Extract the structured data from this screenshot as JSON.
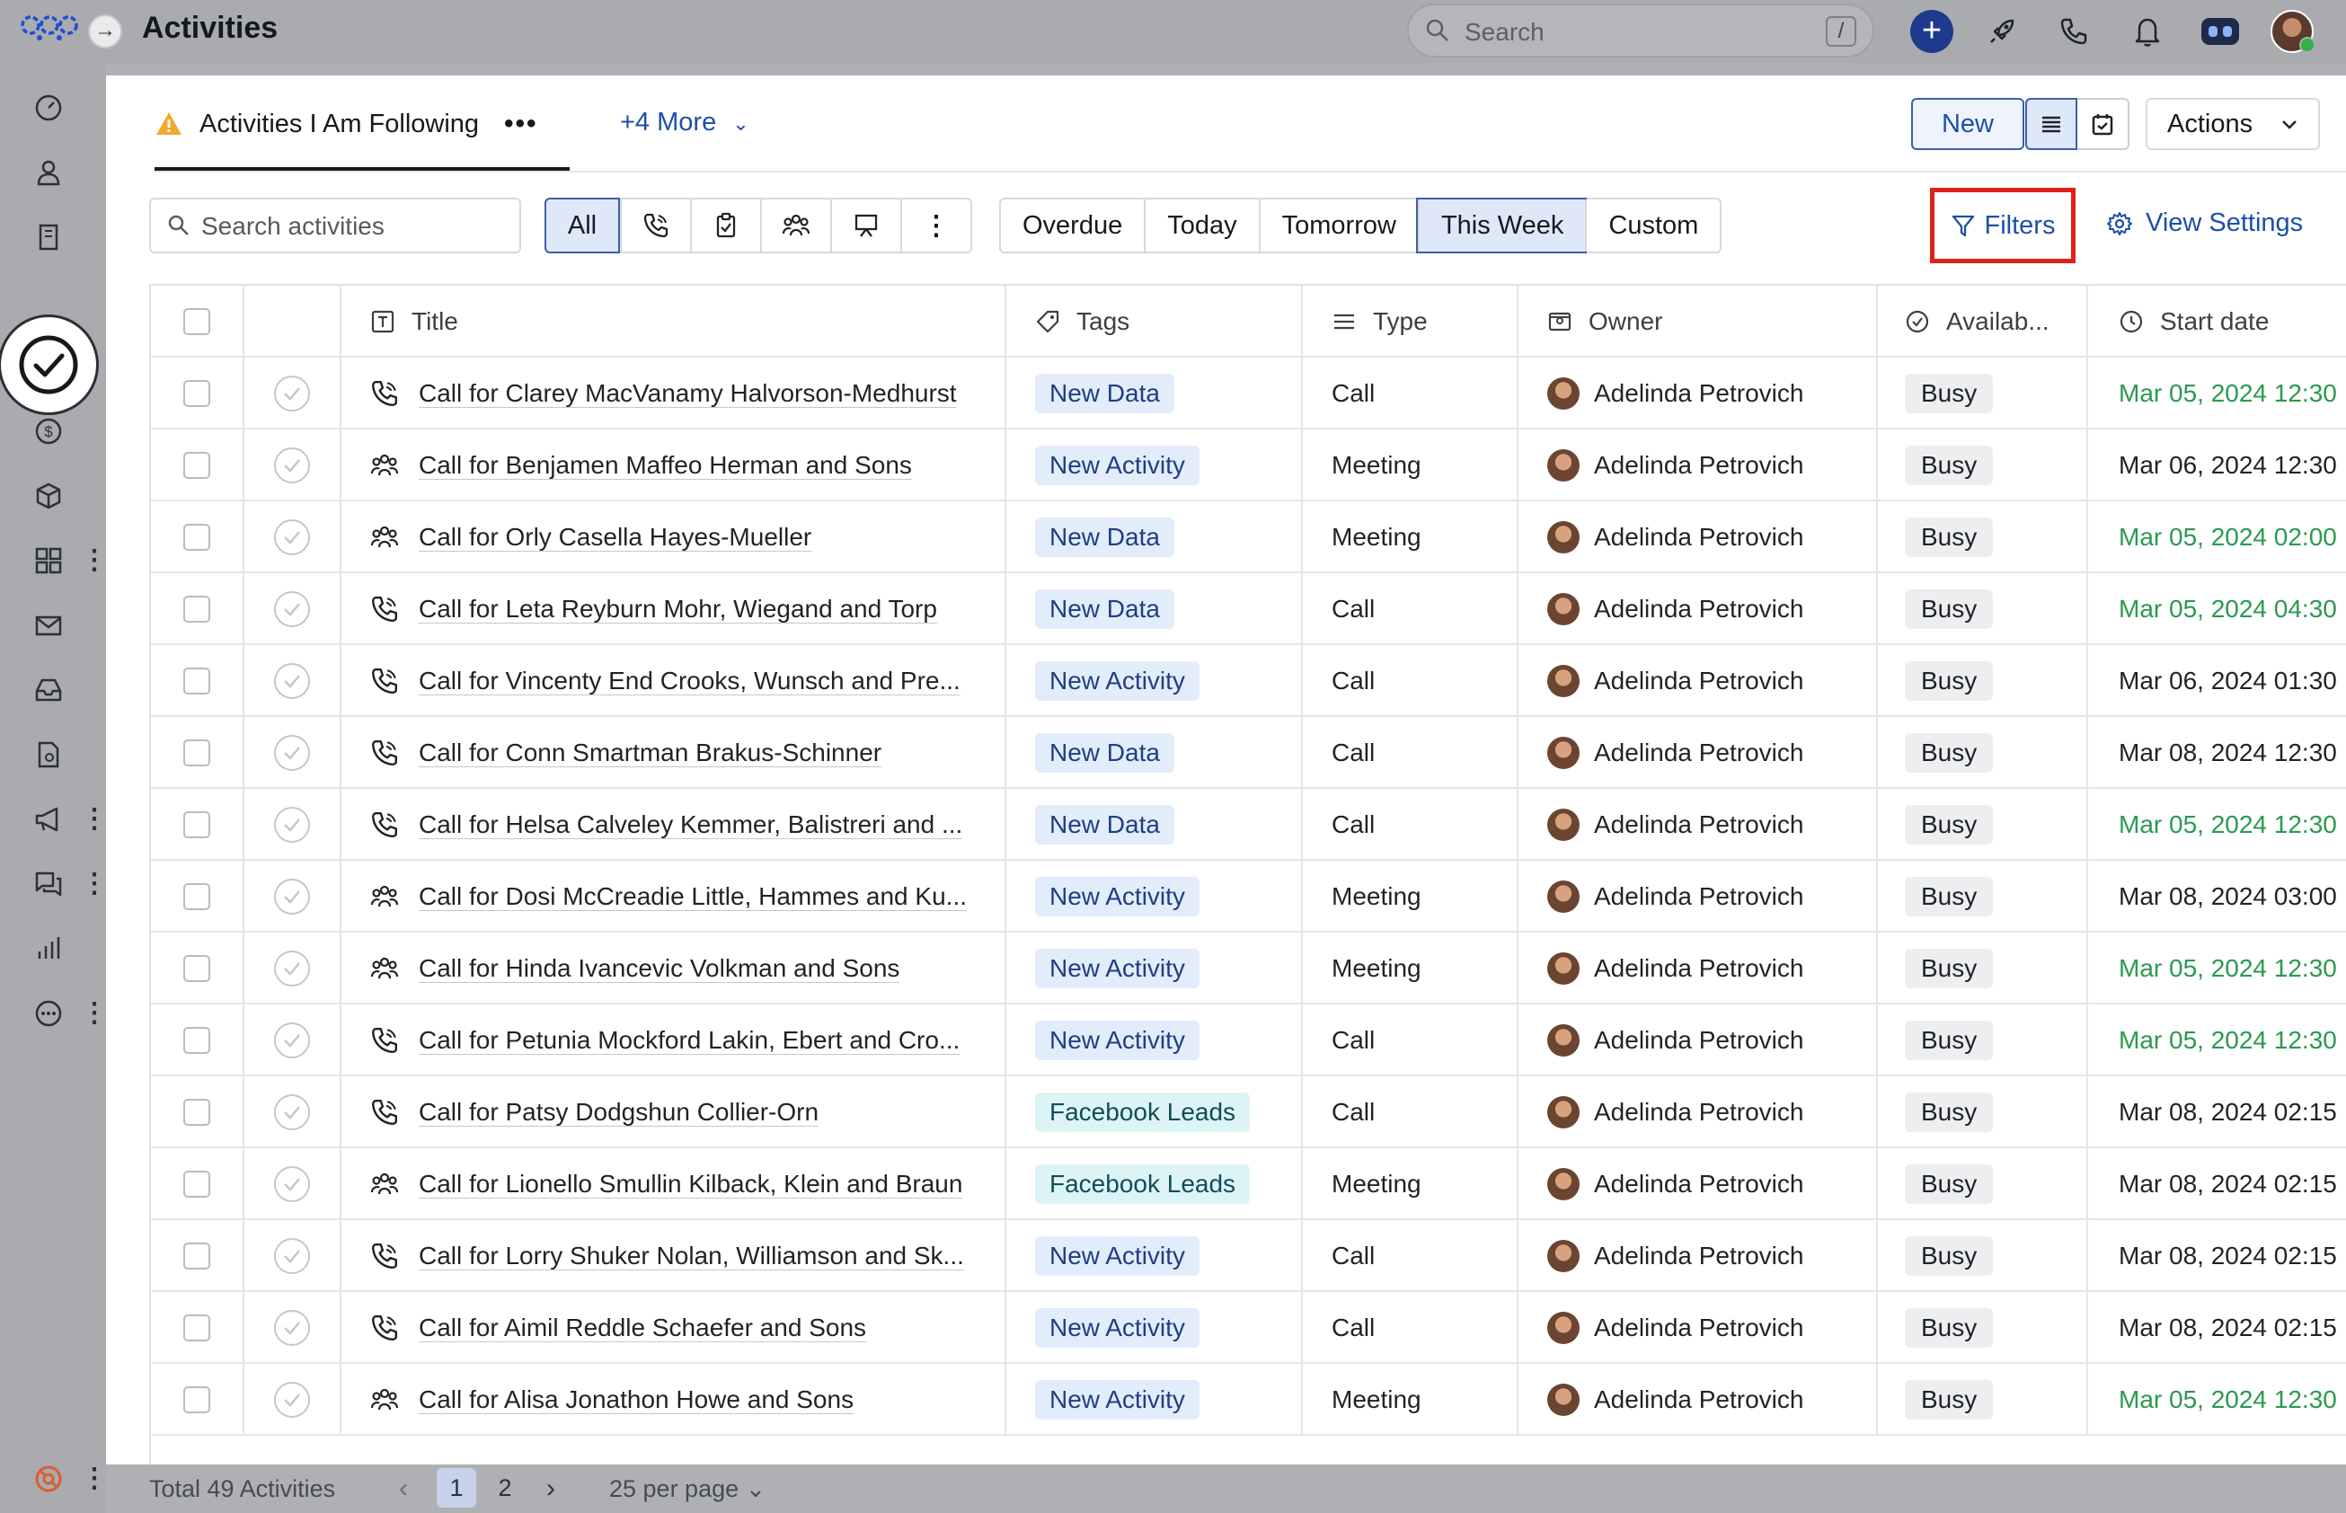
{
  "app": {
    "title": "Activities"
  },
  "header": {
    "search_placeholder": "Search",
    "search_shortcut": "/"
  },
  "view": {
    "current_tab": "Activities I Am Following",
    "more_views": "+4 More",
    "new_label": "New",
    "actions_label": "Actions"
  },
  "filters": {
    "search_placeholder": "Search activities",
    "type_all": "All",
    "date_options": [
      "Overdue",
      "Today",
      "Tomorrow",
      "This Week",
      "Custom"
    ],
    "date_selected": "This Week",
    "filters_label": "Filters",
    "view_settings_label": "View Settings"
  },
  "table": {
    "columns": {
      "title": "Title",
      "tags": "Tags",
      "type": "Type",
      "owner": "Owner",
      "availability": "Availab...",
      "start_date": "Start date"
    },
    "rows": [
      {
        "title": "Call for Clarey MacVanamy Halvorson-Medhurst",
        "icon": "phone-icon",
        "tag": "New Data",
        "tag_style": "blue",
        "type": "Call",
        "owner": "Adelinda Petrovich",
        "availability": "Busy",
        "start": "Mar 05, 2024 12:30",
        "start_green": true
      },
      {
        "title": "Call for Benjamen Maffeo Herman and Sons",
        "icon": "meeting-icon",
        "tag": "New Activity",
        "tag_style": "blue",
        "type": "Meeting",
        "owner": "Adelinda Petrovich",
        "availability": "Busy",
        "start": "Mar 06, 2024 12:30",
        "start_green": false
      },
      {
        "title": "Call for Orly Casella Hayes-Mueller",
        "icon": "meeting-icon",
        "tag": "New Data",
        "tag_style": "blue",
        "type": "Meeting",
        "owner": "Adelinda Petrovich",
        "availability": "Busy",
        "start": "Mar 05, 2024 02:00",
        "start_green": true
      },
      {
        "title": "Call for Leta Reyburn Mohr, Wiegand and Torp",
        "icon": "phone-icon",
        "tag": "New Data",
        "tag_style": "blue",
        "type": "Call",
        "owner": "Adelinda Petrovich",
        "availability": "Busy",
        "start": "Mar 05, 2024 04:30",
        "start_green": true
      },
      {
        "title": "Call for Vincenty End Crooks, Wunsch and Pre...",
        "icon": "phone-icon",
        "tag": "New Activity",
        "tag_style": "blue",
        "type": "Call",
        "owner": "Adelinda Petrovich",
        "availability": "Busy",
        "start": "Mar 06, 2024 01:30",
        "start_green": false
      },
      {
        "title": "Call for Conn Smartman Brakus-Schinner",
        "icon": "phone-icon",
        "tag": "New Data",
        "tag_style": "blue",
        "type": "Call",
        "owner": "Adelinda Petrovich",
        "availability": "Busy",
        "start": "Mar 08, 2024 12:30",
        "start_green": false
      },
      {
        "title": "Call for Helsa Calveley Kemmer, Balistreri and ...",
        "icon": "phone-icon",
        "tag": "New Data",
        "tag_style": "blue",
        "type": "Call",
        "owner": "Adelinda Petrovich",
        "availability": "Busy",
        "start": "Mar 05, 2024 12:30",
        "start_green": true
      },
      {
        "title": "Call for Dosi McCreadie Little, Hammes and Ku...",
        "icon": "meeting-icon",
        "tag": "New Activity",
        "tag_style": "blue",
        "type": "Meeting",
        "owner": "Adelinda Petrovich",
        "availability": "Busy",
        "start": "Mar 08, 2024 03:00",
        "start_green": false
      },
      {
        "title": "Call for Hinda Ivancevic Volkman and Sons",
        "icon": "meeting-icon",
        "tag": "New Activity",
        "tag_style": "blue",
        "type": "Meeting",
        "owner": "Adelinda Petrovich",
        "availability": "Busy",
        "start": "Mar 05, 2024 12:30",
        "start_green": true
      },
      {
        "title": "Call for Petunia Mockford Lakin, Ebert and Cro...",
        "icon": "phone-icon",
        "tag": "New Activity",
        "tag_style": "blue",
        "type": "Call",
        "owner": "Adelinda Petrovich",
        "availability": "Busy",
        "start": "Mar 05, 2024 12:30",
        "start_green": true
      },
      {
        "title": "Call for Patsy Dodgshun Collier-Orn",
        "icon": "phone-icon",
        "tag": "Facebook Leads",
        "tag_style": "teal",
        "type": "Call",
        "owner": "Adelinda Petrovich",
        "availability": "Busy",
        "start": "Mar 08, 2024 02:15",
        "start_green": false
      },
      {
        "title": "Call for Lionello Smullin Kilback, Klein and Braun",
        "icon": "meeting-icon",
        "tag": "Facebook Leads",
        "tag_style": "teal",
        "type": "Meeting",
        "owner": "Adelinda Petrovich",
        "availability": "Busy",
        "start": "Mar 08, 2024 02:15",
        "start_green": false
      },
      {
        "title": "Call for Lorry Shuker Nolan, Williamson and Sk...",
        "icon": "phone-icon",
        "tag": "New Activity",
        "tag_style": "blue",
        "type": "Call",
        "owner": "Adelinda Petrovich",
        "availability": "Busy",
        "start": "Mar 08, 2024 02:15",
        "start_green": false
      },
      {
        "title": "Call for Aimil Reddle Schaefer and Sons",
        "icon": "phone-icon",
        "tag": "New Activity",
        "tag_style": "blue",
        "type": "Call",
        "owner": "Adelinda Petrovich",
        "availability": "Busy",
        "start": "Mar 08, 2024 02:15",
        "start_green": false
      },
      {
        "title": "Call for Alisa Jonathon Howe and Sons",
        "icon": "meeting-icon",
        "tag": "New Activity",
        "tag_style": "blue",
        "type": "Meeting",
        "owner": "Adelinda Petrovich",
        "availability": "Busy",
        "start": "Mar 05, 2024 12:30",
        "start_green": true
      }
    ]
  },
  "footer": {
    "total": "Total 49 Activities",
    "pages": [
      "1",
      "2"
    ],
    "current_page": "1",
    "per_page": "25 per page"
  },
  "colors": {
    "accent": "#1d4fa8",
    "highlight_box": "#e0201c",
    "date_green": "#2a9a4f"
  }
}
